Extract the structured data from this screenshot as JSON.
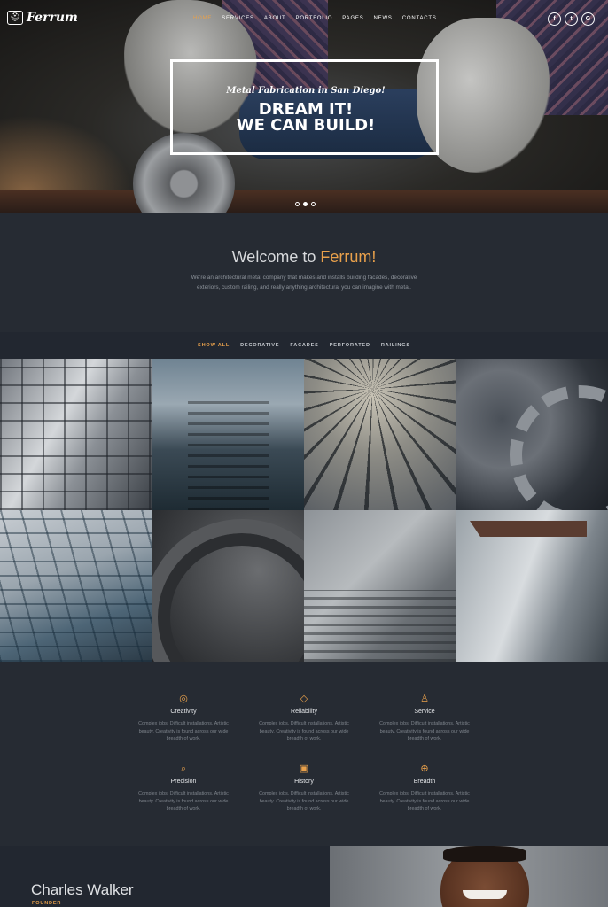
{
  "brand": {
    "name": "Ferrum",
    "logo_icon": "helmet-icon"
  },
  "nav": {
    "items": [
      {
        "label": "HOME",
        "active": true
      },
      {
        "label": "SERVICES",
        "active": false
      },
      {
        "label": "ABOUT",
        "active": false
      },
      {
        "label": "PORTFOLIO",
        "active": false
      },
      {
        "label": "PAGES",
        "active": false
      },
      {
        "label": "NEWS",
        "active": false
      },
      {
        "label": "CONTACTS",
        "active": false
      }
    ],
    "social": [
      {
        "icon": "facebook-icon",
        "glyph": "f"
      },
      {
        "icon": "twitter-icon",
        "glyph": "t"
      },
      {
        "icon": "google-icon",
        "glyph": "G"
      }
    ]
  },
  "hero": {
    "tagline": "Metal Fabrication in San Diego!",
    "headline_1": "DREAM IT!",
    "headline_2": "WE CAN BUILD!",
    "slides": 3,
    "active_slide": 2
  },
  "welcome": {
    "title_prefix": "Welcome to ",
    "title_accent": "Ferrum!",
    "text": "We're an architectural metal company that makes and installs building facades, decorative exteriors, custom railing, and really anything architectural you can imagine with metal."
  },
  "filter": {
    "items": [
      {
        "label": "SHOW ALL",
        "active": true
      },
      {
        "label": "DECORATIVE",
        "active": false
      },
      {
        "label": "FACADES",
        "active": false
      },
      {
        "label": "PERFORATED",
        "active": false
      },
      {
        "label": "RAILINGS",
        "active": false
      }
    ]
  },
  "gallery": {
    "tiles": [
      "glass-facade-tile",
      "stairs-tile",
      "dome-tile",
      "gears-tile",
      "glass-tower-tile",
      "clock-tile",
      "railing-stairs-tile",
      "steel-beam-tile"
    ]
  },
  "features": [
    {
      "icon": "lightbulb-icon",
      "glyph": "◎",
      "title": "Creativity",
      "desc": "Complex jobs. Difficult installations. Artistic beauty. Creativity is found across our wide breadth of work."
    },
    {
      "icon": "diamond-icon",
      "glyph": "◇",
      "title": "Reliability",
      "desc": "Complex jobs. Difficult installations. Artistic beauty. Creativity is found across our wide breadth of work."
    },
    {
      "icon": "user-icon",
      "glyph": "♙",
      "title": "Service",
      "desc": "Complex jobs. Difficult installations. Artistic beauty. Creativity is found across our wide breadth of work."
    },
    {
      "icon": "search-icon",
      "glyph": "⌕",
      "title": "Precision",
      "desc": "Complex jobs. Difficult installations. Artistic beauty. Creativity is found across our wide breadth of work."
    },
    {
      "icon": "history-icon",
      "glyph": "▣",
      "title": "History",
      "desc": "Complex jobs. Difficult installations. Artistic beauty. Creativity is found across our wide breadth of work."
    },
    {
      "icon": "globe-icon",
      "glyph": "⊕",
      "title": "Breadth",
      "desc": "Complex jobs. Difficult installations. Artistic beauty. Creativity is found across our wide breadth of work."
    }
  ],
  "founder": {
    "name": "Charles Walker",
    "role": "FOUNDER"
  },
  "colors": {
    "accent": "#e8a04b",
    "background": "#262b33",
    "panel": "#222730"
  }
}
